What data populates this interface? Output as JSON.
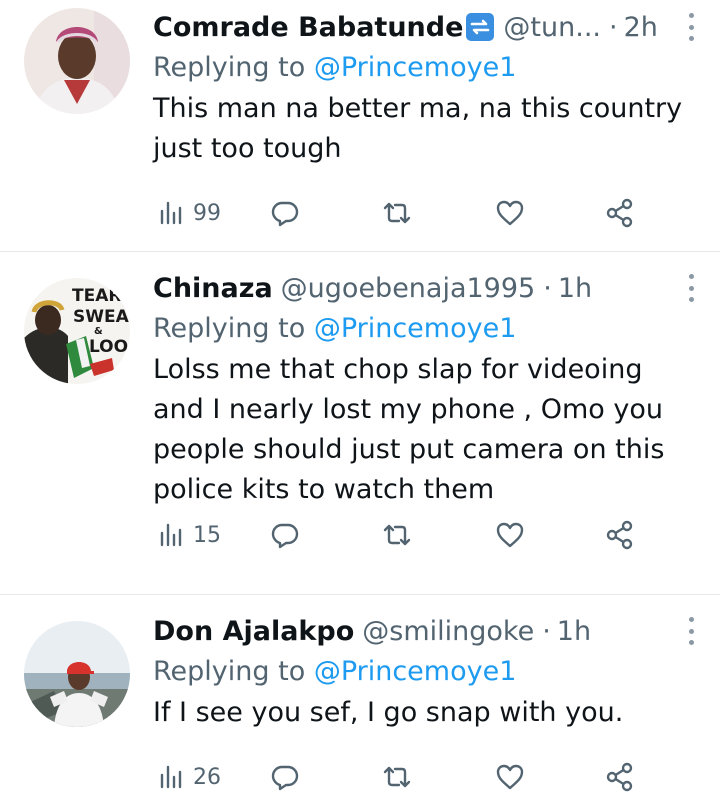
{
  "tweets": [
    {
      "name": "Comrade Babatunde",
      "handle": "@tun...",
      "dot": "·",
      "time": "2h",
      "reply_prefix": "Replying to ",
      "reply_to": "@Princemoye1",
      "text": "This man na better ma, na this country just too tough",
      "views": "99",
      "avatar_icon": "person-avatar",
      "badge_icon": "repeat-badge-icon"
    },
    {
      "name": "Chinaza",
      "handle": "@ugoebenaja1995",
      "dot": "·",
      "time": "1h",
      "reply_prefix": "Replying to ",
      "reply_to": "@Princemoye1",
      "text": "Lolss me that chop slap for videoing and I nearly lost my phone , Omo you people should just put camera on this police kits to watch them",
      "views": "15",
      "avatar_icon": "tears-sweat-blood-avatar",
      "avatar_text": [
        "TEARS",
        "SWEAT",
        "&",
        "BLOOD"
      ]
    },
    {
      "name": "Don Ajalakpo",
      "handle": "@smilingoke",
      "dot": "·",
      "time": "1h",
      "reply_prefix": "Replying to ",
      "reply_to": "@Princemoye1",
      "text": "If I see you sef, I go snap with you.",
      "views": "26",
      "avatar_icon": "beach-person-avatar"
    }
  ],
  "colors": {
    "text": "#0f1419",
    "secondary": "#536471",
    "link": "#1d9bf0",
    "divider": "#e6e9eb"
  }
}
